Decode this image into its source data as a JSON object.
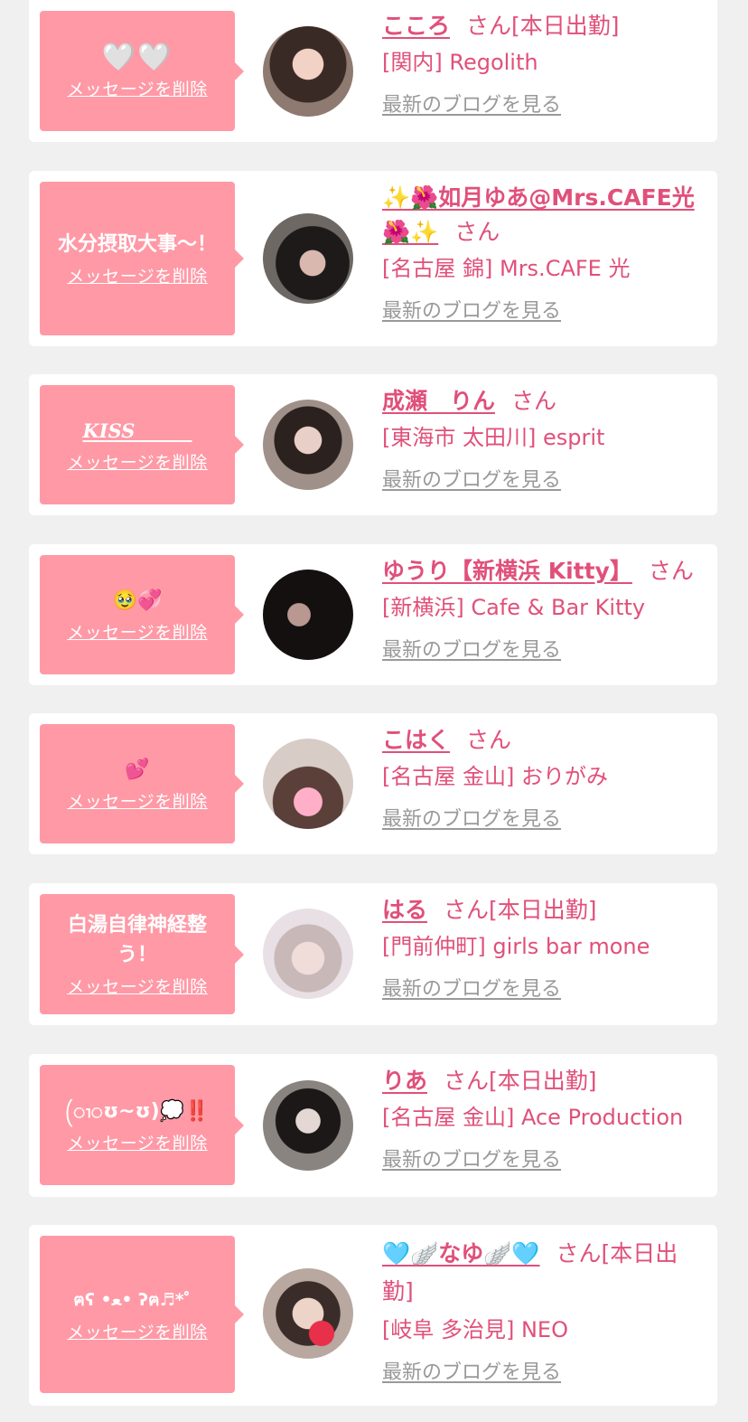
{
  "colors": {
    "accent": "#e0507a",
    "bubble": "#ff99a6",
    "background": "#f0f0f0",
    "card": "#ffffff",
    "muted": "#999999"
  },
  "labels": {
    "san": "さん",
    "delete_message": "メッセージを削除",
    "latest_blog": "最新のブログを見る"
  },
  "items": [
    {
      "message": "🤍🤍",
      "name": "こころ",
      "status": "[本日出勤]",
      "shop": "[関内] Regolith"
    },
    {
      "message": "水分摂取大事〜！",
      "name": "✨🌺如月ゆあ@Mrs.CAFE光🌺✨",
      "status": "",
      "shop": "[名古屋 錦] Mrs.CAFE 光"
    },
    {
      "message": "KISS______",
      "name": "成瀬　りん",
      "status": "",
      "shop": "[東海市 太田川] esprit"
    },
    {
      "message": "🥹💞",
      "name": "ゆうり【新横浜 Kitty】",
      "status": "",
      "shop": "[新横浜] Cafe & Bar Kitty"
    },
    {
      "message": "💕",
      "name": "こはく",
      "status": "",
      "shop": "[名古屋 金山] おりがみ"
    },
    {
      "message": "白湯自律神経整う！",
      "name": "はる",
      "status": "[本日出勤]",
      "shop": "[門前仲町] girls bar mone"
    },
    {
      "message": "(ၢ︎ʊ︎~ʊ︎)💭‼️",
      "name": "りあ",
      "status": "[本日出勤]",
      "shop": "[名古屋 金山] Ace Production"
    },
    {
      "message": "ฅʕ •ﻌ• ʔฅ♬*゜",
      "name": "🩵🪽なゆ🪽🩵",
      "status": "[本日出勤]",
      "shop": "[岐阜 多治見] NEO"
    }
  ]
}
